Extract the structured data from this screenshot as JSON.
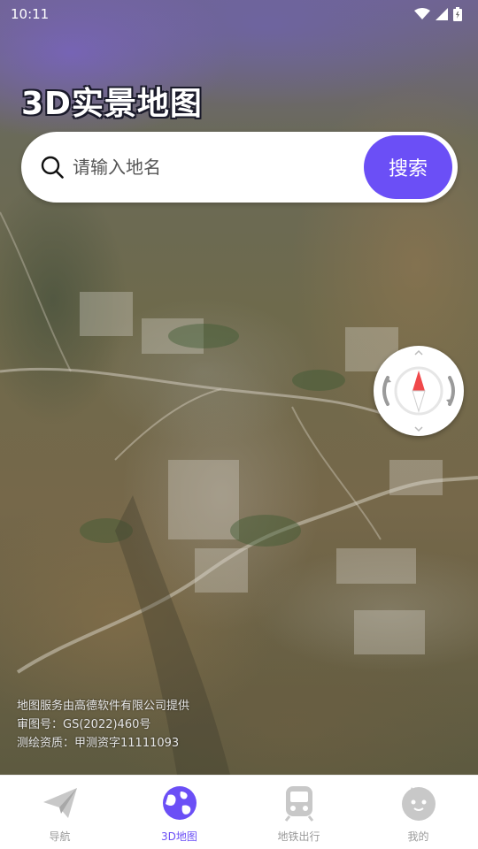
{
  "status_bar": {
    "time": "10:11",
    "icons": [
      "wifi-icon",
      "signal-icon",
      "battery-icon"
    ]
  },
  "header": {
    "title": "3D实景地图"
  },
  "search": {
    "placeholder": "请输入地名",
    "value": "",
    "button_label": "搜索",
    "icon": "search-icon"
  },
  "map": {
    "compass_icon": "compass-icon",
    "attribution": {
      "line1": "地图服务由高德软件有限公司提供",
      "line2": "审图号：GS(2022)460号",
      "line3": "测绘资质：甲测资字11111093"
    }
  },
  "bottom_nav": {
    "items": [
      {
        "label": "导航",
        "icon": "paper-plane-icon",
        "active": false
      },
      {
        "label": "3D地图",
        "icon": "globe-icon",
        "active": true
      },
      {
        "label": "地铁出行",
        "icon": "subway-icon",
        "active": false
      },
      {
        "label": "我的",
        "icon": "profile-face-icon",
        "active": false
      }
    ]
  },
  "colors": {
    "accent": "#6b4ff6",
    "nav_inactive": "#bcbcbc",
    "compass_red": "#f0484a"
  }
}
